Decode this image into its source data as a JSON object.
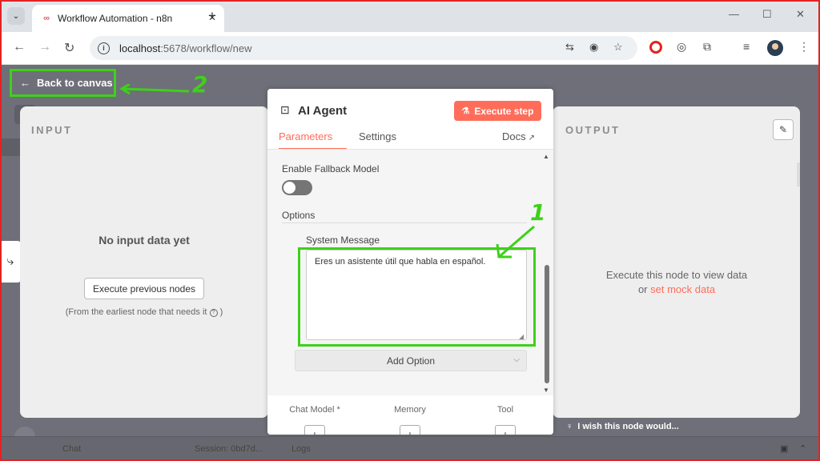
{
  "browser": {
    "tab_title": "Workflow Automation - n8n",
    "url_host": "localhost",
    "url_port": ":5678",
    "url_path": "/workflow/new"
  },
  "canvas": {
    "back_label": "Back to canvas",
    "chat_label": "Chat",
    "session_label": "Session: 0bd7d...",
    "logs_label": "Logs",
    "wish_label": "I wish this node would..."
  },
  "input_panel": {
    "heading": "INPUT",
    "empty_title": "No input data yet",
    "exec_prev_label": "Execute previous nodes",
    "earliest_text": "(From the earliest node that needs it"
  },
  "output_panel": {
    "heading": "OUTPUT",
    "msg_line1": "Execute this node to view data",
    "msg_or": "or",
    "mock_link": "set mock data"
  },
  "node": {
    "title": "AI Agent",
    "execute_label": "Execute step",
    "tabs": {
      "parameters": "Parameters",
      "settings": "Settings",
      "docs": "Docs"
    },
    "fallback_label": "Enable Fallback Model",
    "fallback_enabled": false,
    "options_label": "Options",
    "system_message_label": "System Message",
    "system_message_value": "Eres un asistente útil que habla en español.",
    "add_option_label": "Add Option",
    "connections": [
      "Chat Model *",
      "Memory",
      "Tool"
    ]
  },
  "annotations": {
    "label_1": "1",
    "label_2": "2",
    "color": "#3dd11a"
  },
  "colors": {
    "accent": "#ff6d5a",
    "annotation_green": "#3dd11a",
    "frame_red": "#e32222"
  }
}
